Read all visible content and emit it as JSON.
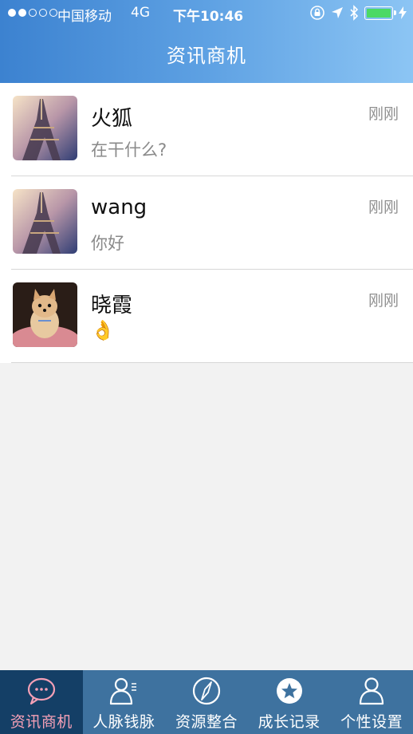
{
  "status_bar": {
    "carrier": "中国移动",
    "network": "4G",
    "time": "下午10:46",
    "battery_color": "#4cd964"
  },
  "header": {
    "title": "资讯商机",
    "gradient": [
      "#3c82d0",
      "#8cc5f4"
    ]
  },
  "messages": [
    {
      "name": "火狐",
      "preview": "在干什么?",
      "time": "刚刚",
      "avatar": "eiffel-tower-photo"
    },
    {
      "name": "wang",
      "preview": "你好",
      "time": "刚刚",
      "avatar": "eiffel-tower-photo"
    },
    {
      "name": "晓霞",
      "preview": "👌",
      "time": "刚刚",
      "avatar": "puppy-photo"
    }
  ],
  "tabs": [
    {
      "label": "资讯商机",
      "icon": "chat-bubble-icon",
      "active": true
    },
    {
      "label": "人脉钱脉",
      "icon": "contacts-icon",
      "active": false
    },
    {
      "label": "资源整合",
      "icon": "compass-icon",
      "active": false
    },
    {
      "label": "成长记录",
      "icon": "star-icon",
      "active": false
    },
    {
      "label": "个性设置",
      "icon": "person-icon",
      "active": false
    }
  ],
  "colors": {
    "tab_bar": "#3e729f",
    "tab_active_bg": "#143f66",
    "tab_active_text": "#f5a0b6"
  }
}
